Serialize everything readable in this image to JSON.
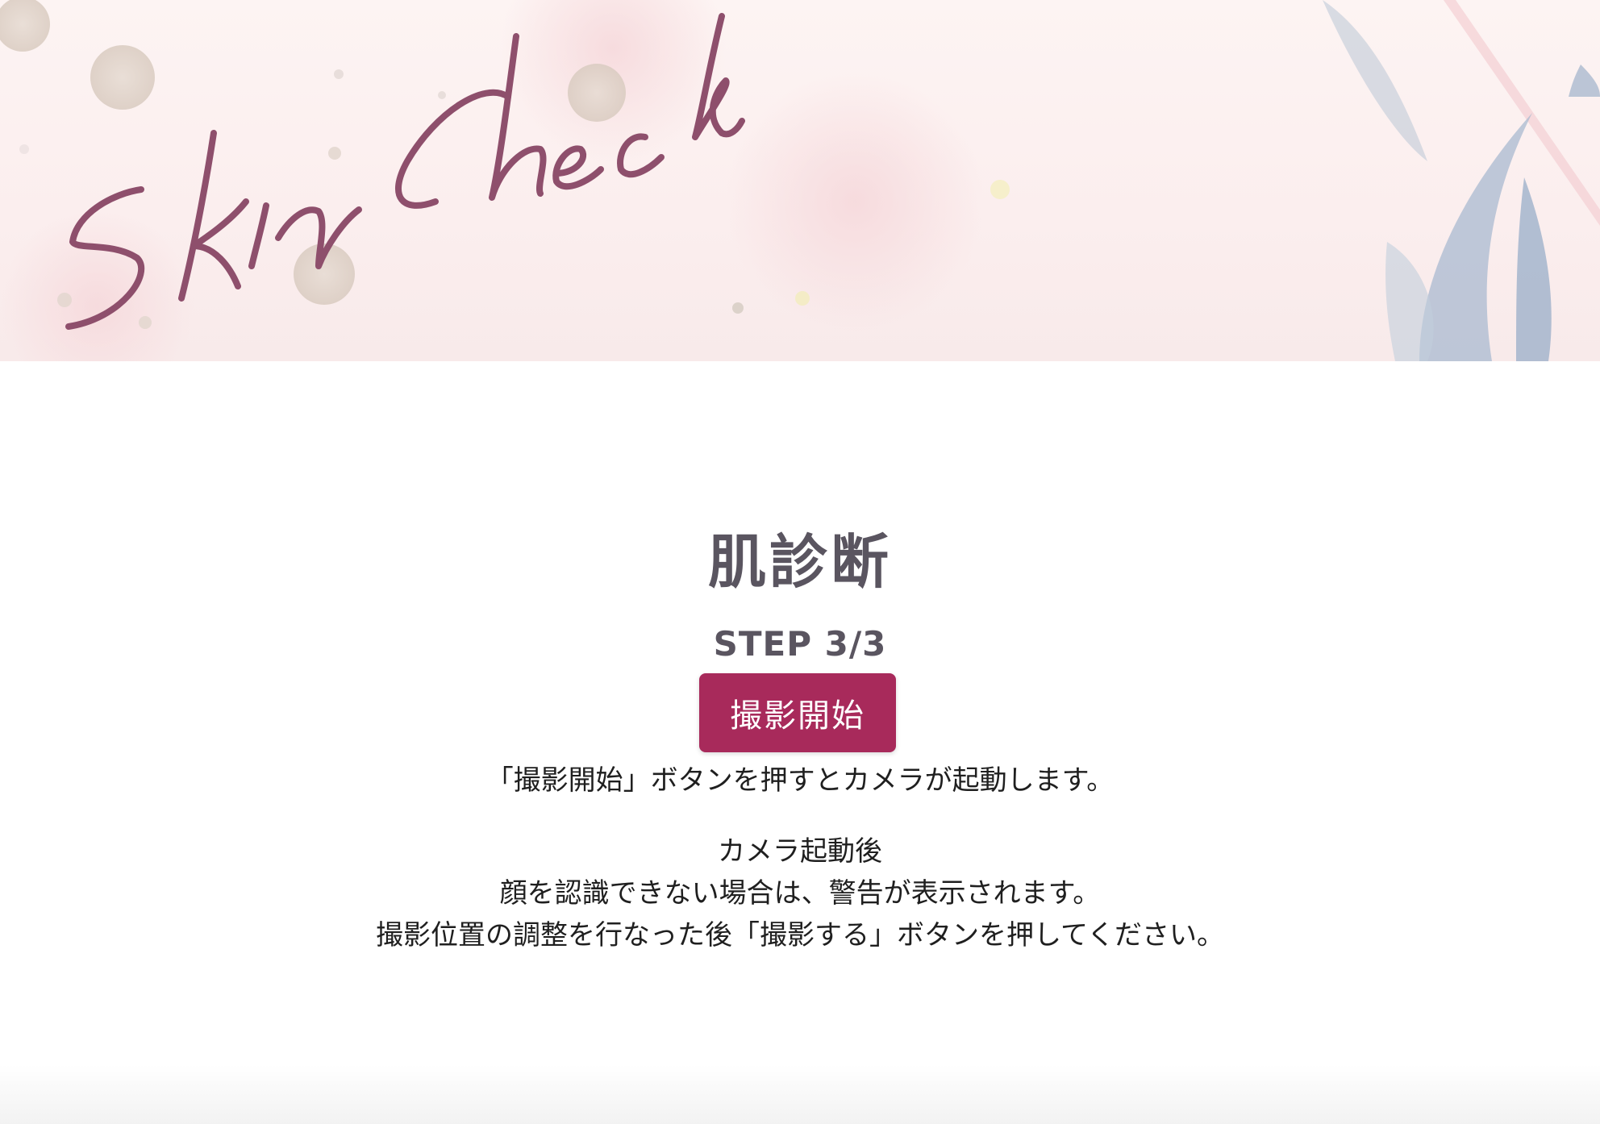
{
  "hero": {
    "logo_text": "Skin Check"
  },
  "main": {
    "title": "肌診断",
    "step": "STEP 3/3",
    "intro": "「撮影開始」ボタンを押すとカメラが起動します。",
    "instructions": [
      "カメラ起動後",
      "顔を認識できない場合は、警告が表示されます。",
      "撮影位置の調整を行なった後「撮影する」ボタンを押してください。"
    ],
    "start_button_label": "撮影開始"
  },
  "colors": {
    "accent": "#a82a5b",
    "logo": "#8e4f6c",
    "heading": "#5a5560",
    "hero_bg": "#fdf4f3"
  },
  "icons": {
    "logo": "skin-check-script-logo",
    "decor": "watercolor-leaves"
  }
}
